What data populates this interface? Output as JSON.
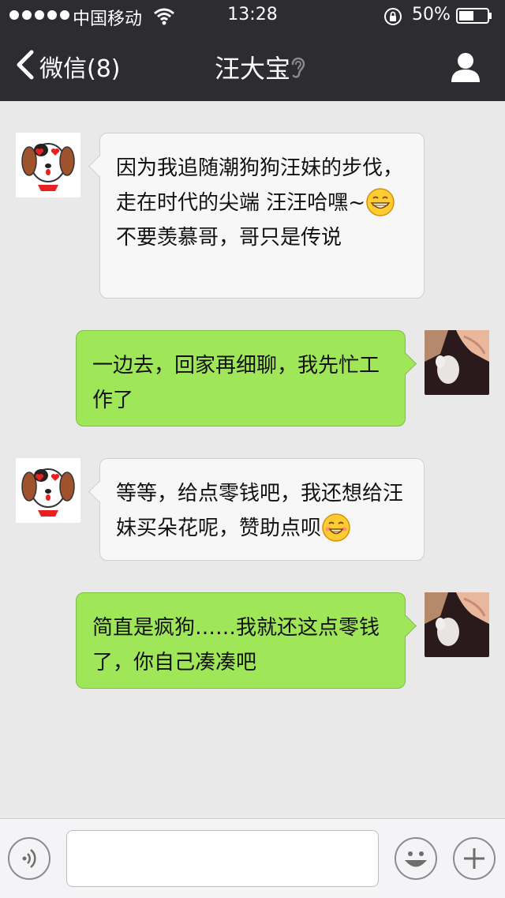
{
  "status_bar": {
    "carrier": "中国移动",
    "time": "13:28",
    "battery": "50%"
  },
  "nav": {
    "back_label": "微信(8)",
    "title": "汪大宝"
  },
  "messages": [
    {
      "side": "in",
      "segments": [
        "因为我追随潮狗狗汪妹的步伐，走在时代的尖端 汪汪哈嘿~",
        "不要羡慕哥，哥只是传说"
      ]
    },
    {
      "side": "out",
      "segments": [
        "一边去，回家再细聊，我先忙工作了"
      ]
    },
    {
      "side": "in",
      "segments": [
        "等等，给点零钱吧，我还想给汪妹买朵花呢，赞助点呗"
      ]
    },
    {
      "side": "out",
      "segments": [
        "简直是疯狗……我就还这点零钱了，你自己凑凑吧"
      ]
    }
  ],
  "input_bar": {
    "text_value": ""
  },
  "icons": {
    "back": "chevron-left-icon",
    "ear": "ear-icon",
    "profile": "profile-icon",
    "voice": "voice-icon",
    "emoji": "emoji-icon",
    "plus": "plus-icon"
  },
  "colors": {
    "nav_bg": "#2d2d31",
    "chat_bg": "#e9e9e9",
    "incoming_bubble": "#f7f7f7",
    "outgoing_bubble": "#9fe658"
  }
}
